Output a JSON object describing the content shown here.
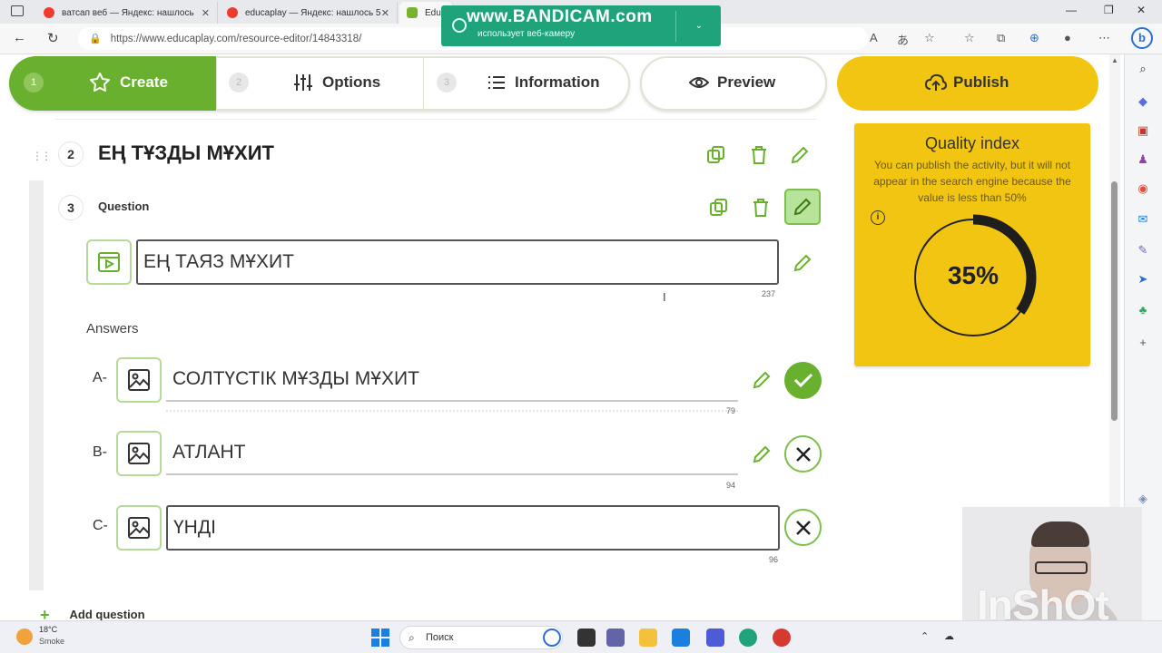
{
  "browser": {
    "tabs": [
      {
        "title": "ватсап веб — Яндекс: нашлось"
      },
      {
        "title": "educaplay — Яндекс: нашлось 5"
      },
      {
        "title": "Educ"
      }
    ],
    "url": "https://www.educaplay.com/resource-editor/14843318/"
  },
  "bandicam": {
    "brand": "www.BANDICAM.com",
    "notice": "использует веб-камеру"
  },
  "steps": [
    {
      "num": "1",
      "label": "Create"
    },
    {
      "num": "2",
      "label": "Options"
    },
    {
      "num": "3",
      "label": "Information"
    }
  ],
  "actions": {
    "preview": "Preview",
    "publish": "Publish"
  },
  "editor": {
    "q2": {
      "num": "2",
      "title": "ЕҢ ТҰЗДЫ МҰХИТ"
    },
    "q3": {
      "num": "3",
      "label": "Question",
      "text": "ЕҢ ТАЯЗ МҰХИТ",
      "chars_left": "237"
    },
    "answers_label": "Answers",
    "answers": [
      {
        "letter": "A-",
        "text": "СОЛТҮСТІК МҰЗДЫ МҰХИТ",
        "chars_left": "79",
        "status": "correct"
      },
      {
        "letter": "B-",
        "text": "АТЛАНТ",
        "chars_left": "94",
        "status": "incorrect"
      },
      {
        "letter": "C-",
        "text": "ҮНДІ",
        "chars_left": "96",
        "status": "incorrect"
      }
    ],
    "add_question": "Add question"
  },
  "quality": {
    "title": "Quality index",
    "description": "You can publish the activity, but it will not appear in the search engine because the value is less than 50%",
    "value_label": "35%",
    "value": 0.35,
    "color": "#f2c513"
  },
  "watermark": "InShOt",
  "taskbar": {
    "weather_temp": "18°C",
    "weather_desc": "Smoke",
    "search_placeholder": "Поиск"
  },
  "colors": {
    "accent_green": "#6ab02f",
    "publish_yellow": "#f2c513"
  }
}
